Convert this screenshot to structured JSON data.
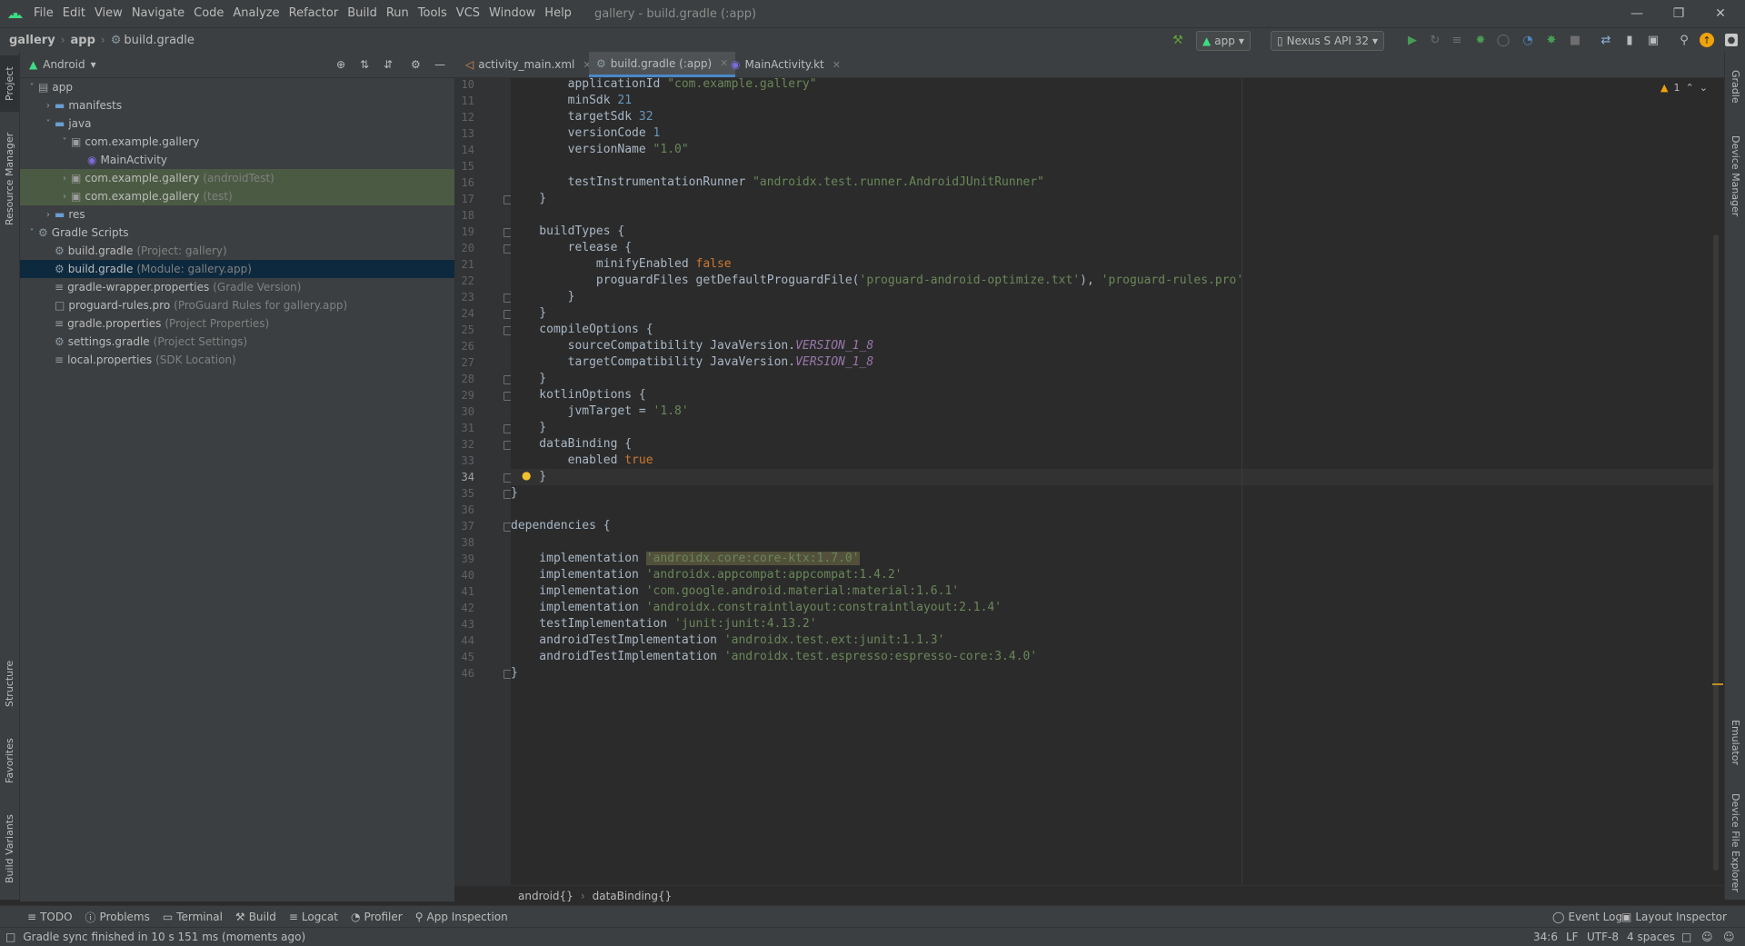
{
  "window": {
    "title": "gallery - build.gradle (:app)",
    "menu": [
      "File",
      "Edit",
      "View",
      "Navigate",
      "Code",
      "Analyze",
      "Refactor",
      "Build",
      "Run",
      "Tools",
      "VCS",
      "Window",
      "Help"
    ]
  },
  "navbar": {
    "crumbs": [
      "gallery",
      "app",
      "build.gradle"
    ],
    "run_config": "app",
    "device": "Nexus S API 32"
  },
  "left_tabs": [
    "Project",
    "Resource Manager",
    "Structure",
    "Favorites",
    "Build Variants"
  ],
  "right_tabs": [
    "Gradle",
    "Device Manager",
    "Emulator",
    "Device File Explorer"
  ],
  "project": {
    "view": "Android",
    "tree": [
      {
        "label": "app",
        "hint": "",
        "indent": 0,
        "arrow": "down",
        "icon": "module"
      },
      {
        "label": "manifests",
        "hint": "",
        "indent": 1,
        "arrow": "right",
        "icon": "folder"
      },
      {
        "label": "java",
        "hint": "",
        "indent": 1,
        "arrow": "down",
        "icon": "folder"
      },
      {
        "label": "com.example.gallery",
        "hint": "",
        "indent": 2,
        "arrow": "down",
        "icon": "package"
      },
      {
        "label": "MainActivity",
        "hint": "",
        "indent": 3,
        "arrow": "",
        "icon": "kotlin"
      },
      {
        "label": "com.example.gallery",
        "hint": "(androidTest)",
        "indent": 2,
        "arrow": "right",
        "icon": "package"
      },
      {
        "label": "com.example.gallery",
        "hint": "(test)",
        "indent": 2,
        "arrow": "right",
        "icon": "package"
      },
      {
        "label": "res",
        "hint": "",
        "indent": 1,
        "arrow": "right",
        "icon": "folder"
      },
      {
        "label": "Gradle Scripts",
        "hint": "",
        "indent": 0,
        "arrow": "down",
        "icon": "gradle"
      },
      {
        "label": "build.gradle",
        "hint": "(Project: gallery)",
        "indent": 1,
        "arrow": "",
        "icon": "gradle"
      },
      {
        "label": "build.gradle",
        "hint": "(Module: gallery.app)",
        "indent": 1,
        "arrow": "",
        "icon": "gradle"
      },
      {
        "label": "gradle-wrapper.properties",
        "hint": "(Gradle Version)",
        "indent": 1,
        "arrow": "",
        "icon": "props"
      },
      {
        "label": "proguard-rules.pro",
        "hint": "(ProGuard Rules for gallery.app)",
        "indent": 1,
        "arrow": "",
        "icon": "file"
      },
      {
        "label": "gradle.properties",
        "hint": "(Project Properties)",
        "indent": 1,
        "arrow": "",
        "icon": "props"
      },
      {
        "label": "settings.gradle",
        "hint": "(Project Settings)",
        "indent": 1,
        "arrow": "",
        "icon": "gradle"
      },
      {
        "label": "local.properties",
        "hint": "(SDK Location)",
        "indent": 1,
        "arrow": "",
        "icon": "props"
      }
    ]
  },
  "editor": {
    "tabs": [
      "activity_main.xml",
      "build.gradle (:app)",
      "MainActivity.kt"
    ],
    "warnings": "1",
    "lines": [
      {
        "n": "10",
        "t": "        applicationId \"com.example.gallery\""
      },
      {
        "n": "11",
        "t": "        minSdk 21"
      },
      {
        "n": "12",
        "t": "        targetSdk 32"
      },
      {
        "n": "13",
        "t": "        versionCode 1"
      },
      {
        "n": "14",
        "t": "        versionName \"1.0\""
      },
      {
        "n": "15",
        "t": ""
      },
      {
        "n": "16",
        "t": "        testInstrumentationRunner \"androidx.test.runner.AndroidJUnitRunner\""
      },
      {
        "n": "17",
        "t": "    }"
      },
      {
        "n": "18",
        "t": ""
      },
      {
        "n": "19",
        "t": "    buildTypes {"
      },
      {
        "n": "20",
        "t": "        release {"
      },
      {
        "n": "21",
        "t": "            minifyEnabled false"
      },
      {
        "n": "22",
        "t": "            proguardFiles getDefaultProguardFile('proguard-android-optimize.txt'), 'proguard-rules.pro'"
      },
      {
        "n": "23",
        "t": "        }"
      },
      {
        "n": "24",
        "t": "    }"
      },
      {
        "n": "25",
        "t": "    compileOptions {"
      },
      {
        "n": "26",
        "t": "        sourceCompatibility JavaVersion.VERSION_1_8"
      },
      {
        "n": "27",
        "t": "        targetCompatibility JavaVersion.VERSION_1_8"
      },
      {
        "n": "28",
        "t": "    }"
      },
      {
        "n": "29",
        "t": "    kotlinOptions {"
      },
      {
        "n": "30",
        "t": "        jvmTarget = '1.8'"
      },
      {
        "n": "31",
        "t": "    }"
      },
      {
        "n": "32",
        "t": "    dataBinding {"
      },
      {
        "n": "33",
        "t": "        enabled true"
      },
      {
        "n": "34",
        "t": "    }"
      },
      {
        "n": "35",
        "t": "}"
      },
      {
        "n": "36",
        "t": ""
      },
      {
        "n": "37",
        "t": "dependencies {"
      },
      {
        "n": "38",
        "t": ""
      },
      {
        "n": "39",
        "t": "    implementation 'androidx.core:core-ktx:1.7.0'"
      },
      {
        "n": "40",
        "t": "    implementation 'androidx.appcompat:appcompat:1.4.2'"
      },
      {
        "n": "41",
        "t": "    implementation 'com.google.android.material:material:1.6.1'"
      },
      {
        "n": "42",
        "t": "    implementation 'androidx.constraintlayout:constraintlayout:2.1.4'"
      },
      {
        "n": "43",
        "t": "    testImplementation 'junit:junit:4.13.2'"
      },
      {
        "n": "44",
        "t": "    androidTestImplementation 'androidx.test.ext:junit:1.1.3'"
      },
      {
        "n": "45",
        "t": "    androidTestImplementation 'androidx.test.espresso:espresso-core:3.4.0'"
      },
      {
        "n": "46",
        "t": "}"
      }
    ],
    "breadcrumb": [
      "android{}",
      "dataBinding{}"
    ]
  },
  "bottom_tools": [
    "TODO",
    "Problems",
    "Terminal",
    "Build",
    "Logcat",
    "Profiler",
    "App Inspection"
  ],
  "bottom_right_tools": [
    "Event Log",
    "Layout Inspector"
  ],
  "status": {
    "message": "Gradle sync finished in 10 s 151 ms (moments ago)",
    "position": "34:6",
    "line_sep": "LF",
    "encoding": "UTF-8",
    "indent": "4 spaces"
  },
  "colors": {
    "accent": "#4a88c7",
    "string": "#6a8759",
    "number": "#6897bb",
    "keyword": "#cc7832",
    "constant": "#9876aa"
  }
}
